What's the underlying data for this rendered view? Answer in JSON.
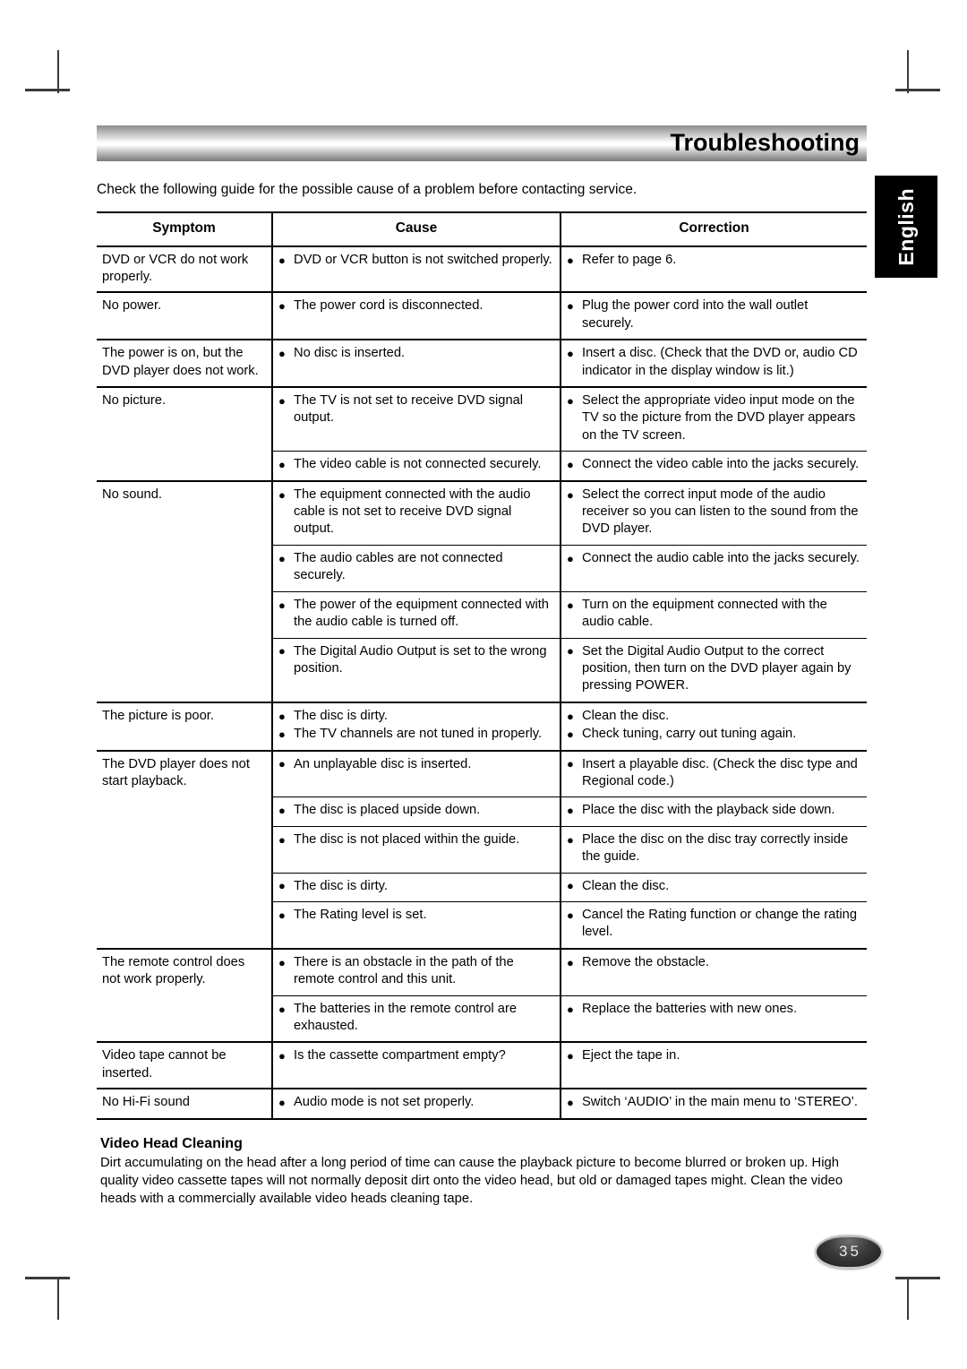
{
  "language_tab": {
    "label": "English"
  },
  "header": {
    "title": "Troubleshooting"
  },
  "intro": "Check the following guide for the possible cause of a problem before contacting service.",
  "table": {
    "columns": [
      "Symptom",
      "Cause",
      "Correction"
    ],
    "rows": [
      {
        "symptom": "DVD or VCR do not work properly.",
        "cause": [
          "DVD or VCR button is not switched properly."
        ],
        "correction": [
          "Refer to page 6."
        ],
        "group": true
      },
      {
        "symptom": "No power.",
        "cause": [
          "The power cord is disconnected."
        ],
        "correction": [
          "Plug the power cord into the wall outlet securely."
        ],
        "group": true
      },
      {
        "symptom": "The power is on, but the DVD player does not work.",
        "cause": [
          "No disc is inserted."
        ],
        "correction": [
          "Insert a disc. (Check that the DVD or, audio CD indicator in the display window is lit.)"
        ],
        "group": true
      },
      {
        "symptom": "No picture.",
        "cause": [
          "The TV is not set to receive DVD signal output."
        ],
        "correction": [
          "Select the appropriate video input mode on the TV so the picture from the DVD player appears on the TV screen."
        ],
        "group": true
      },
      {
        "symptom": "",
        "cause": [
          "The video cable is not connected securely."
        ],
        "correction": [
          "Connect the video cable into the jacks securely."
        ],
        "group": false
      },
      {
        "symptom": "No sound.",
        "cause": [
          "The equipment connected with the audio cable is not set to receive DVD signal output."
        ],
        "correction": [
          "Select the correct input mode of the audio receiver so you can listen to the sound from the DVD player."
        ],
        "group": true
      },
      {
        "symptom": "",
        "cause": [
          "The audio cables are not connected securely."
        ],
        "correction": [
          "Connect the audio cable into the jacks securely."
        ],
        "group": false
      },
      {
        "symptom": "",
        "cause": [
          "The power of the equipment connected with the audio cable is turned off."
        ],
        "correction": [
          "Turn on the equipment connected with the audio cable."
        ],
        "group": false
      },
      {
        "symptom": "",
        "cause": [
          "The Digital Audio Output is set to the wrong position."
        ],
        "correction": [
          "Set the Digital Audio Output to the correct position, then turn on the DVD player again by pressing POWER."
        ],
        "group": false
      },
      {
        "symptom": "The picture is  poor.",
        "cause": [
          "The disc is dirty.",
          "The TV channels are not tuned in properly."
        ],
        "correction": [
          "Clean the disc.",
          "Check tuning, carry out tuning again."
        ],
        "group": true
      },
      {
        "symptom": "The DVD player does not start playback.",
        "cause": [
          "An unplayable disc is inserted."
        ],
        "correction": [
          "Insert a playable disc. (Check the disc type and Regional code.)"
        ],
        "group": true
      },
      {
        "symptom": "",
        "cause": [
          "The disc is placed upside down."
        ],
        "correction": [
          "Place the disc with the playback side down."
        ],
        "group": false
      },
      {
        "symptom": "",
        "cause": [
          "The disc is not placed within the guide."
        ],
        "correction": [
          "Place the disc on the disc tray correctly inside the guide."
        ],
        "group": false
      },
      {
        "symptom": "",
        "cause": [
          "The disc is dirty."
        ],
        "correction": [
          "Clean the disc."
        ],
        "group": false
      },
      {
        "symptom": "",
        "cause": [
          "The Rating level is set."
        ],
        "correction": [
          "Cancel the Rating function or change the rating  level."
        ],
        "group": false
      },
      {
        "symptom": "The remote control does not work properly.",
        "cause": [
          "There is an obstacle in the path of the remote control and this unit."
        ],
        "correction": [
          "Remove the obstacle."
        ],
        "group": true
      },
      {
        "symptom": "",
        "cause": [
          "The batteries in the remote control are exhausted."
        ],
        "correction": [
          "Replace the batteries with new ones."
        ],
        "group": false
      },
      {
        "symptom": "Video tape cannot be inserted.",
        "cause": [
          "Is the cassette compartment empty?"
        ],
        "correction": [
          "Eject the tape in."
        ],
        "group": true
      },
      {
        "symptom": "No Hi-Fi sound",
        "cause": [
          "Audio mode is not set properly."
        ],
        "correction": [
          "Switch ‘AUDIO’ in the main menu to ‘STEREO’."
        ],
        "group": true
      }
    ]
  },
  "video_head_cleaning": {
    "heading": "Video Head Cleaning",
    "body": "Dirt accumulating on the head after a long period of time can cause the playback picture to become blurred or broken up. High quality video cassette tapes will not normally deposit dirt onto the video head, but old or damaged tapes might. Clean the video heads with a commercially available video heads cleaning tape."
  },
  "page_number": "35",
  "bullet_glyph": "●"
}
